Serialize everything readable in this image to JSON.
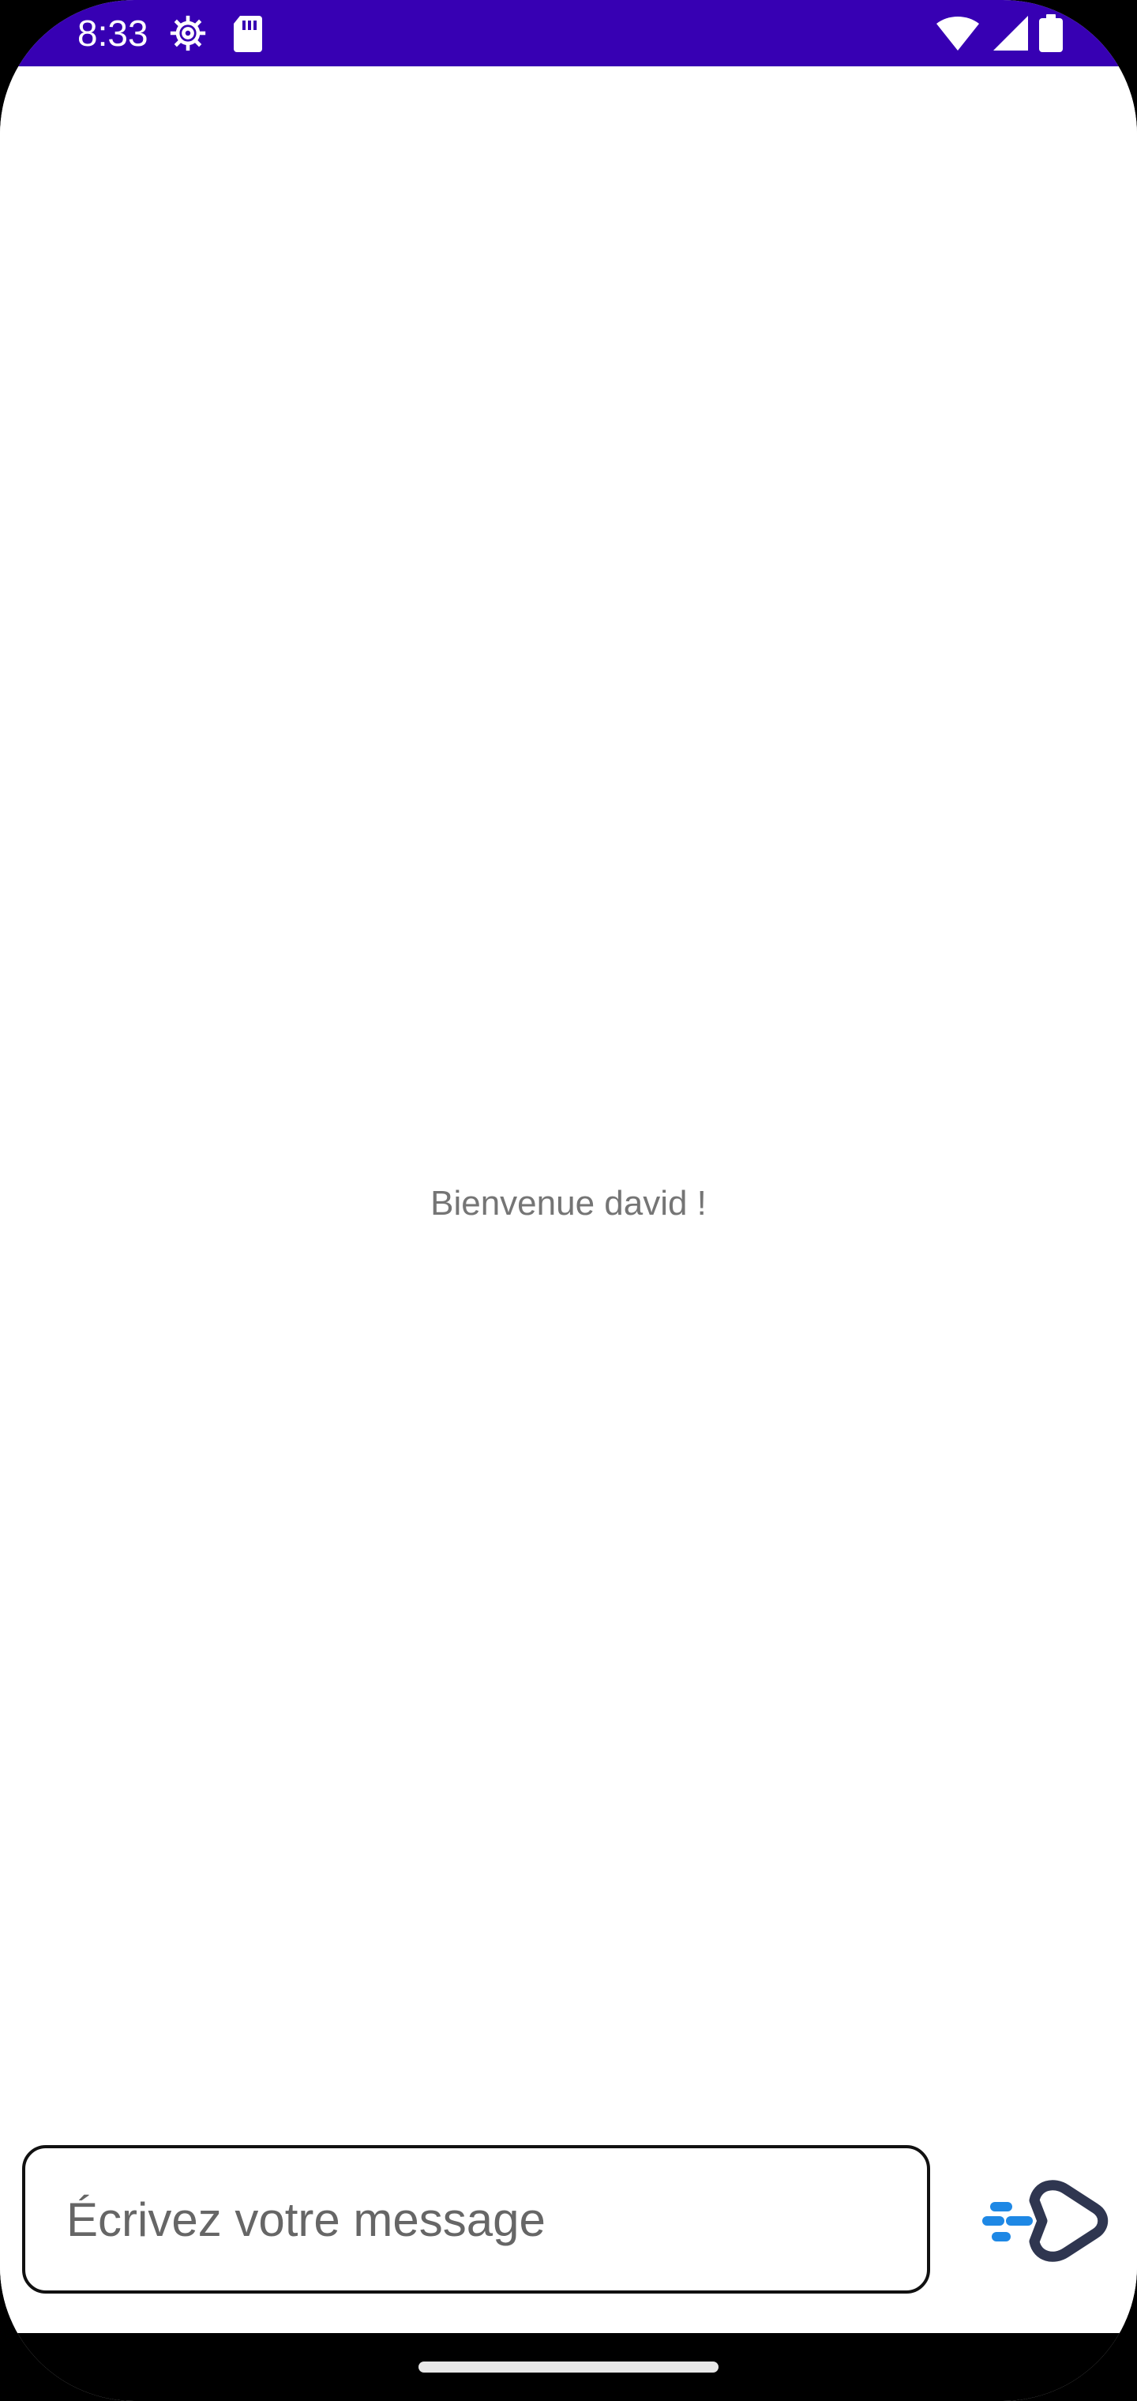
{
  "status_bar": {
    "time": "8:33",
    "color": "#3700b3",
    "icons": [
      "settings-icon",
      "sd-card-icon",
      "wifi-icon",
      "cellular-signal-icon",
      "battery-icon"
    ]
  },
  "main": {
    "welcome_text": "Bienvenue david !"
  },
  "composer": {
    "placeholder": "Écrivez votre message",
    "value": "",
    "send_icon": "send-icon",
    "send_icon_colors": {
      "outline": "#2f3650",
      "speed_lines": "#1e88e5"
    }
  },
  "nav_bar": {
    "home_handle": "home-indicator"
  }
}
